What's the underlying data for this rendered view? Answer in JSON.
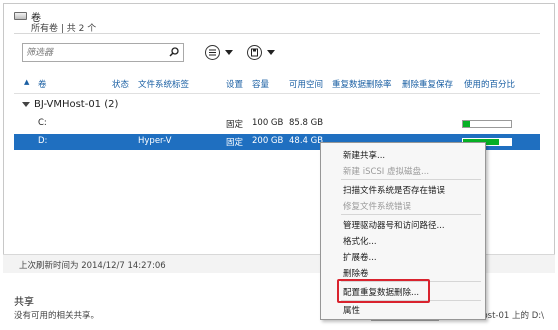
{
  "volumes_panel": {
    "title": "卷",
    "subtitle": "所有卷 | 共 2 个",
    "filter_placeholder": "筛选器",
    "columns": [
      "卷",
      "状态",
      "文件系统标签",
      "设置",
      "容量",
      "可用空间",
      "重复数据删除率",
      "删除重复保存",
      "使用的百分比"
    ],
    "group_label": "BJ-VMHost-01 (2)",
    "rows": [
      {
        "volume": "C:",
        "status": "",
        "label": "",
        "setting": "固定",
        "capacity": "100 GB",
        "free": "85.8 GB",
        "usage_fraction": 0.14
      },
      {
        "volume": "D:",
        "status": "",
        "label": "Hyper-V",
        "setting": "固定",
        "capacity": "200 GB",
        "free": "48.4 GB",
        "usage_fraction": 0.76
      }
    ],
    "last_refresh": "上次刷新时间为 2014/12/7 14:27:06"
  },
  "share_panel": {
    "title": "共享",
    "subtitle": "没有可用的相关共享。",
    "bottom_right": "BJ-VMHost-01 上的 D:\\"
  },
  "context_menu": {
    "items": [
      {
        "label": "新建共享...",
        "enabled": true
      },
      {
        "label": "新建 iSCSI 虚拟磁盘...",
        "enabled": false
      },
      {
        "label": "扫描文件系统是否存在错误",
        "enabled": true
      },
      {
        "label": "修复文件系统错误",
        "enabled": false
      },
      {
        "label": "管理驱动器号和访问路径...",
        "enabled": true
      },
      {
        "label": "格式化...",
        "enabled": true
      },
      {
        "label": "扩展卷...",
        "enabled": true
      },
      {
        "label": "删除卷",
        "enabled": true
      },
      {
        "label": "配置重复数据删除...",
        "enabled": true
      },
      {
        "label": "属性",
        "enabled": true
      }
    ]
  },
  "colors": {
    "selection": "#1f6fc0",
    "usage_bar": "#06b025",
    "highlight_box": "#d9232e",
    "column_text": "#1a5fa3"
  }
}
